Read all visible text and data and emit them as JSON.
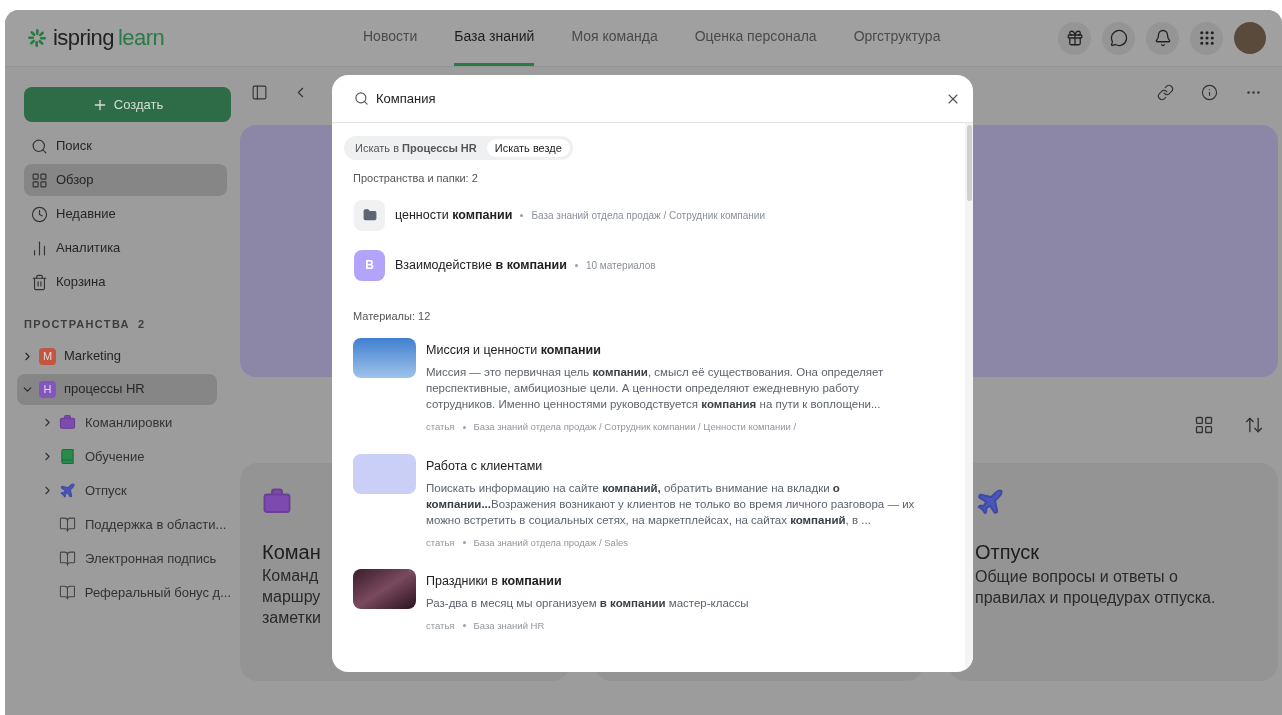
{
  "logo": {
    "brand": "ispring",
    "product": "learn"
  },
  "nav": [
    {
      "label": "Новости",
      "selected": false
    },
    {
      "label": "База знаний",
      "selected": true
    },
    {
      "label": "Моя команда",
      "selected": false
    },
    {
      "label": "Оценка персонала",
      "selected": false
    },
    {
      "label": "Оргструктура",
      "selected": false
    }
  ],
  "sidebar": {
    "create_button": "Создать",
    "items": [
      {
        "kind": "search",
        "label": "Поиск",
        "selected": false
      },
      {
        "kind": "overview",
        "label": "Обзор",
        "selected": true
      },
      {
        "kind": "recent",
        "label": "Недавние",
        "selected": false
      },
      {
        "kind": "analytics",
        "label": "Аналитика",
        "selected": false
      },
      {
        "kind": "trash",
        "label": "Корзина",
        "selected": false
      }
    ],
    "spaces_header": {
      "label": "ПРОСТРАНСТВА",
      "count": "2"
    },
    "tree": [
      {
        "label": "Marketing",
        "letter": "M",
        "color": "#c4553f",
        "expanded": false,
        "selected": false
      },
      {
        "label": "процессы HR",
        "letter": "H",
        "color": "#8456bd",
        "expanded": true,
        "selected": true,
        "children": [
          {
            "kind": "briefcase",
            "label": "Команлировки",
            "expanded": false
          },
          {
            "kind": "book",
            "label": "Обучение",
            "expanded": false
          },
          {
            "kind": "plane",
            "label": "Отпуск",
            "expanded": false
          },
          {
            "kind": "article",
            "label": "Поддержка в области..."
          },
          {
            "kind": "article",
            "label": "Электронная подпись"
          },
          {
            "kind": "article",
            "label": "Реферальный бонус д..."
          }
        ]
      }
    ]
  },
  "cards": [
    {
      "kind": "briefcase",
      "title": "Коман",
      "lines": [
        "Команд",
        "маршру",
        "заметки"
      ]
    },
    {
      "kind": "plane",
      "title": "Отпуск",
      "description": "Общие вопросы и ответы о правилах и процедурах отпуска."
    }
  ],
  "search_dialog": {
    "query": "Компания",
    "scopes": [
      {
        "label": "Искать в **Процессы HR**",
        "selected": false
      },
      {
        "label": "Искать везде",
        "selected": true
      }
    ],
    "spaces_heading": "Пространства и папки: 2",
    "spaces": [
      {
        "kind": "folder",
        "title": "ценности **компании**",
        "meta": "База знаний отдела продаж / Сотрудник компании"
      },
      {
        "kind": "space",
        "letter": "В",
        "title": "Взаимодействие **в компании**",
        "meta": "10 материалов"
      }
    ],
    "materials_heading": "Материалы: 12",
    "materials": [
      {
        "kind": "city",
        "title": "Миссия и ценности **компании**",
        "snippet": "Миссия — это первичная цель **компании**, смысл её существования. Она определяет перспективные, амбициозные цели. А ценности определяют ежедневную работу сотрудников. Именно ценностями руководствуется **компания** на пути к воплощени...",
        "type": "статья",
        "path": "База знаний отдела продаж / Сотрудник компании / Ценности компании /"
      },
      {
        "kind": "illustration",
        "title": "Работа с клиентами",
        "snippet": "Поискать информацию на сайте **компаний,** обратить внимание на вкладки **о компании...**Возражения возникают у клиентов не только во время личного разговора — их можно встретить в социальных сетях, на маркетплейсах, на сайтах **компаний**, в ...",
        "type": "статья",
        "path": "База знаний отдела продаж / Sales"
      },
      {
        "kind": "lights",
        "title": "Праздники в **компании**",
        "snippet": "Раз-два в месяц мы организуем **в компании** мастер-классы",
        "type": "статья",
        "path": "База знаний HR"
      }
    ]
  }
}
